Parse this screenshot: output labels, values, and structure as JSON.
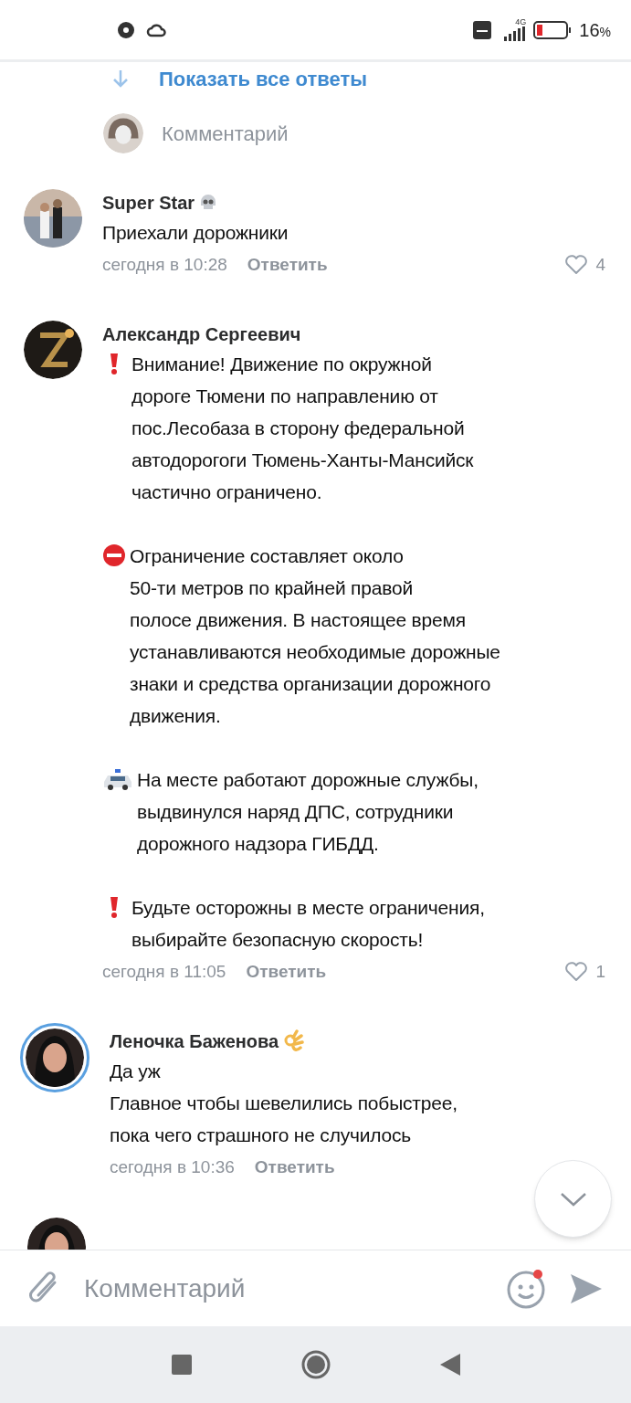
{
  "status_bar": {
    "battery_text": "16",
    "battery_unit": "%",
    "network": "4G"
  },
  "show_replies": {
    "label": "Показать все ответы"
  },
  "reply_field": {
    "placeholder": "Комментарий"
  },
  "comments": [
    {
      "author": "Super Star",
      "paragraphs": [
        {
          "kind": "plain",
          "text": "Приехали дорожники"
        }
      ],
      "time": "сегодня в 10:28",
      "reply": "Ответить",
      "likes": "4",
      "ring": false
    },
    {
      "author": "Александр Сергеевич",
      "paragraphs": [
        {
          "kind": "alert",
          "text": "Внимание! Движение по окружной\nдороге Тюмени по направлению от\nпос.Лесобаза в сторону федеральной\nавтодорогоги Тюмень-Ханты-Мансийск\nчастично ограничено."
        },
        {
          "kind": "restriction",
          "text": "Ограничение составляет около\n50-ти метров по крайней правой\nполосе движения. В настоящее время\nустанавливаются необходимые дорожные\nзнаки и средства организации дорожного\nдвижения."
        },
        {
          "kind": "police",
          "text": "На месте работают дорожные службы,\nвыдвинулся наряд ДПС, сотрудники\nдорожного надзора ГИБДД."
        },
        {
          "kind": "alert",
          "text": "Будьте осторожны в месте ограничения,\nвыбирайте безопасную скорость!"
        }
      ],
      "time": "сегодня в 11:05",
      "reply": "Ответить",
      "likes": "1",
      "ring": false
    },
    {
      "author": "Леночка Баженова",
      "paragraphs": [
        {
          "kind": "plain",
          "text": "Да уж\nГлавное чтобы шевелились побыстрее,\nпока чего страшного не случилось"
        }
      ],
      "time": "сегодня в 10:36",
      "reply": "Ответить",
      "ring": true
    }
  ],
  "composer": {
    "placeholder": "Комментарий"
  }
}
